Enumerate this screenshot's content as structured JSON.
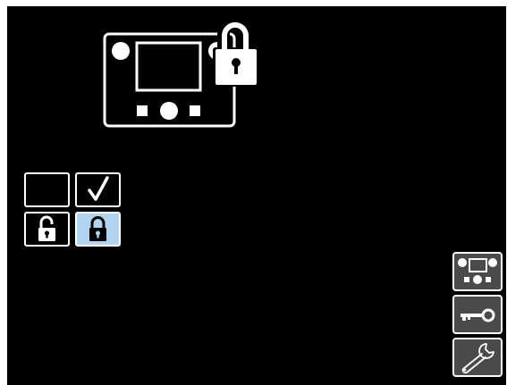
{
  "screen": {
    "background_color": "#000000",
    "foreground_color": "#ffffff",
    "selected_color": "#b3d4f0",
    "side_button_color": "#4a4a4a"
  },
  "header_graphic": {
    "icon": "locked-panel-icon",
    "panel_icon": "machine-panel-icon",
    "lock_icon": "padlock-locked-icon"
  },
  "lock_options": {
    "selected_index": 3,
    "items": [
      {
        "icon": "blank-icon",
        "state": "empty"
      },
      {
        "icon": "checkmark-icon",
        "state": "confirm"
      },
      {
        "icon": "padlock-unlocked-icon",
        "state": "unlocked"
      },
      {
        "icon": "padlock-locked-icon",
        "state": "locked",
        "selected": true
      }
    ]
  },
  "side_menu": {
    "items": [
      {
        "icon": "machine-panel-icon",
        "label": "panel"
      },
      {
        "icon": "key-icon",
        "label": "key"
      },
      {
        "icon": "wrench-icon",
        "label": "wrench"
      }
    ]
  }
}
